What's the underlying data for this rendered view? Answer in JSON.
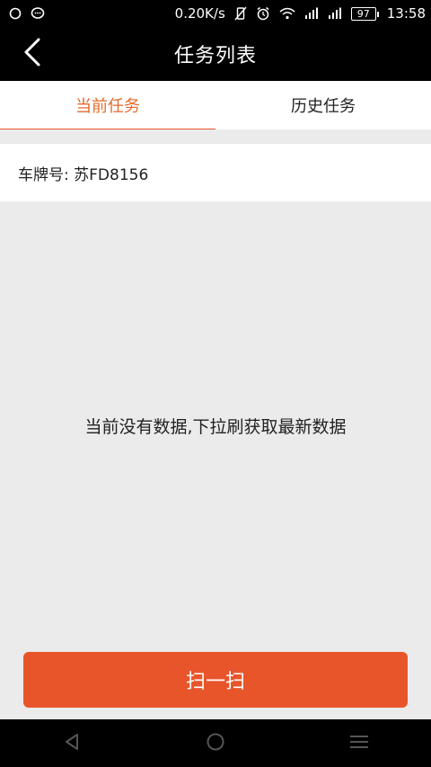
{
  "status_bar": {
    "network_speed": "0.20K/s",
    "battery": "97",
    "time": "13:58",
    "icons": [
      "circle-notification-icon",
      "chat-bubble-icon",
      "vibrate-off-icon",
      "alarm-icon",
      "wifi-icon",
      "signal-icon",
      "signal-icon",
      "battery-icon"
    ]
  },
  "header": {
    "title": "任务列表",
    "back_icon": "chevron-left-icon"
  },
  "tabs": [
    {
      "label": "当前任务",
      "active": true
    },
    {
      "label": "历史任务",
      "active": false
    }
  ],
  "vehicle": {
    "plate_label": "车牌号: 苏FD8156"
  },
  "empty_state": {
    "message": "当前没有数据,下拉刷获取最新数据"
  },
  "actions": {
    "scan_label": "扫一扫"
  },
  "system_nav": {
    "icons": [
      "back-triangle-icon",
      "home-circle-icon",
      "menu-lines-icon"
    ]
  },
  "colors": {
    "accent": "#e8552a",
    "active_tab_text": "#e46a2b",
    "background": "#ebebeb",
    "bar": "#000000"
  }
}
